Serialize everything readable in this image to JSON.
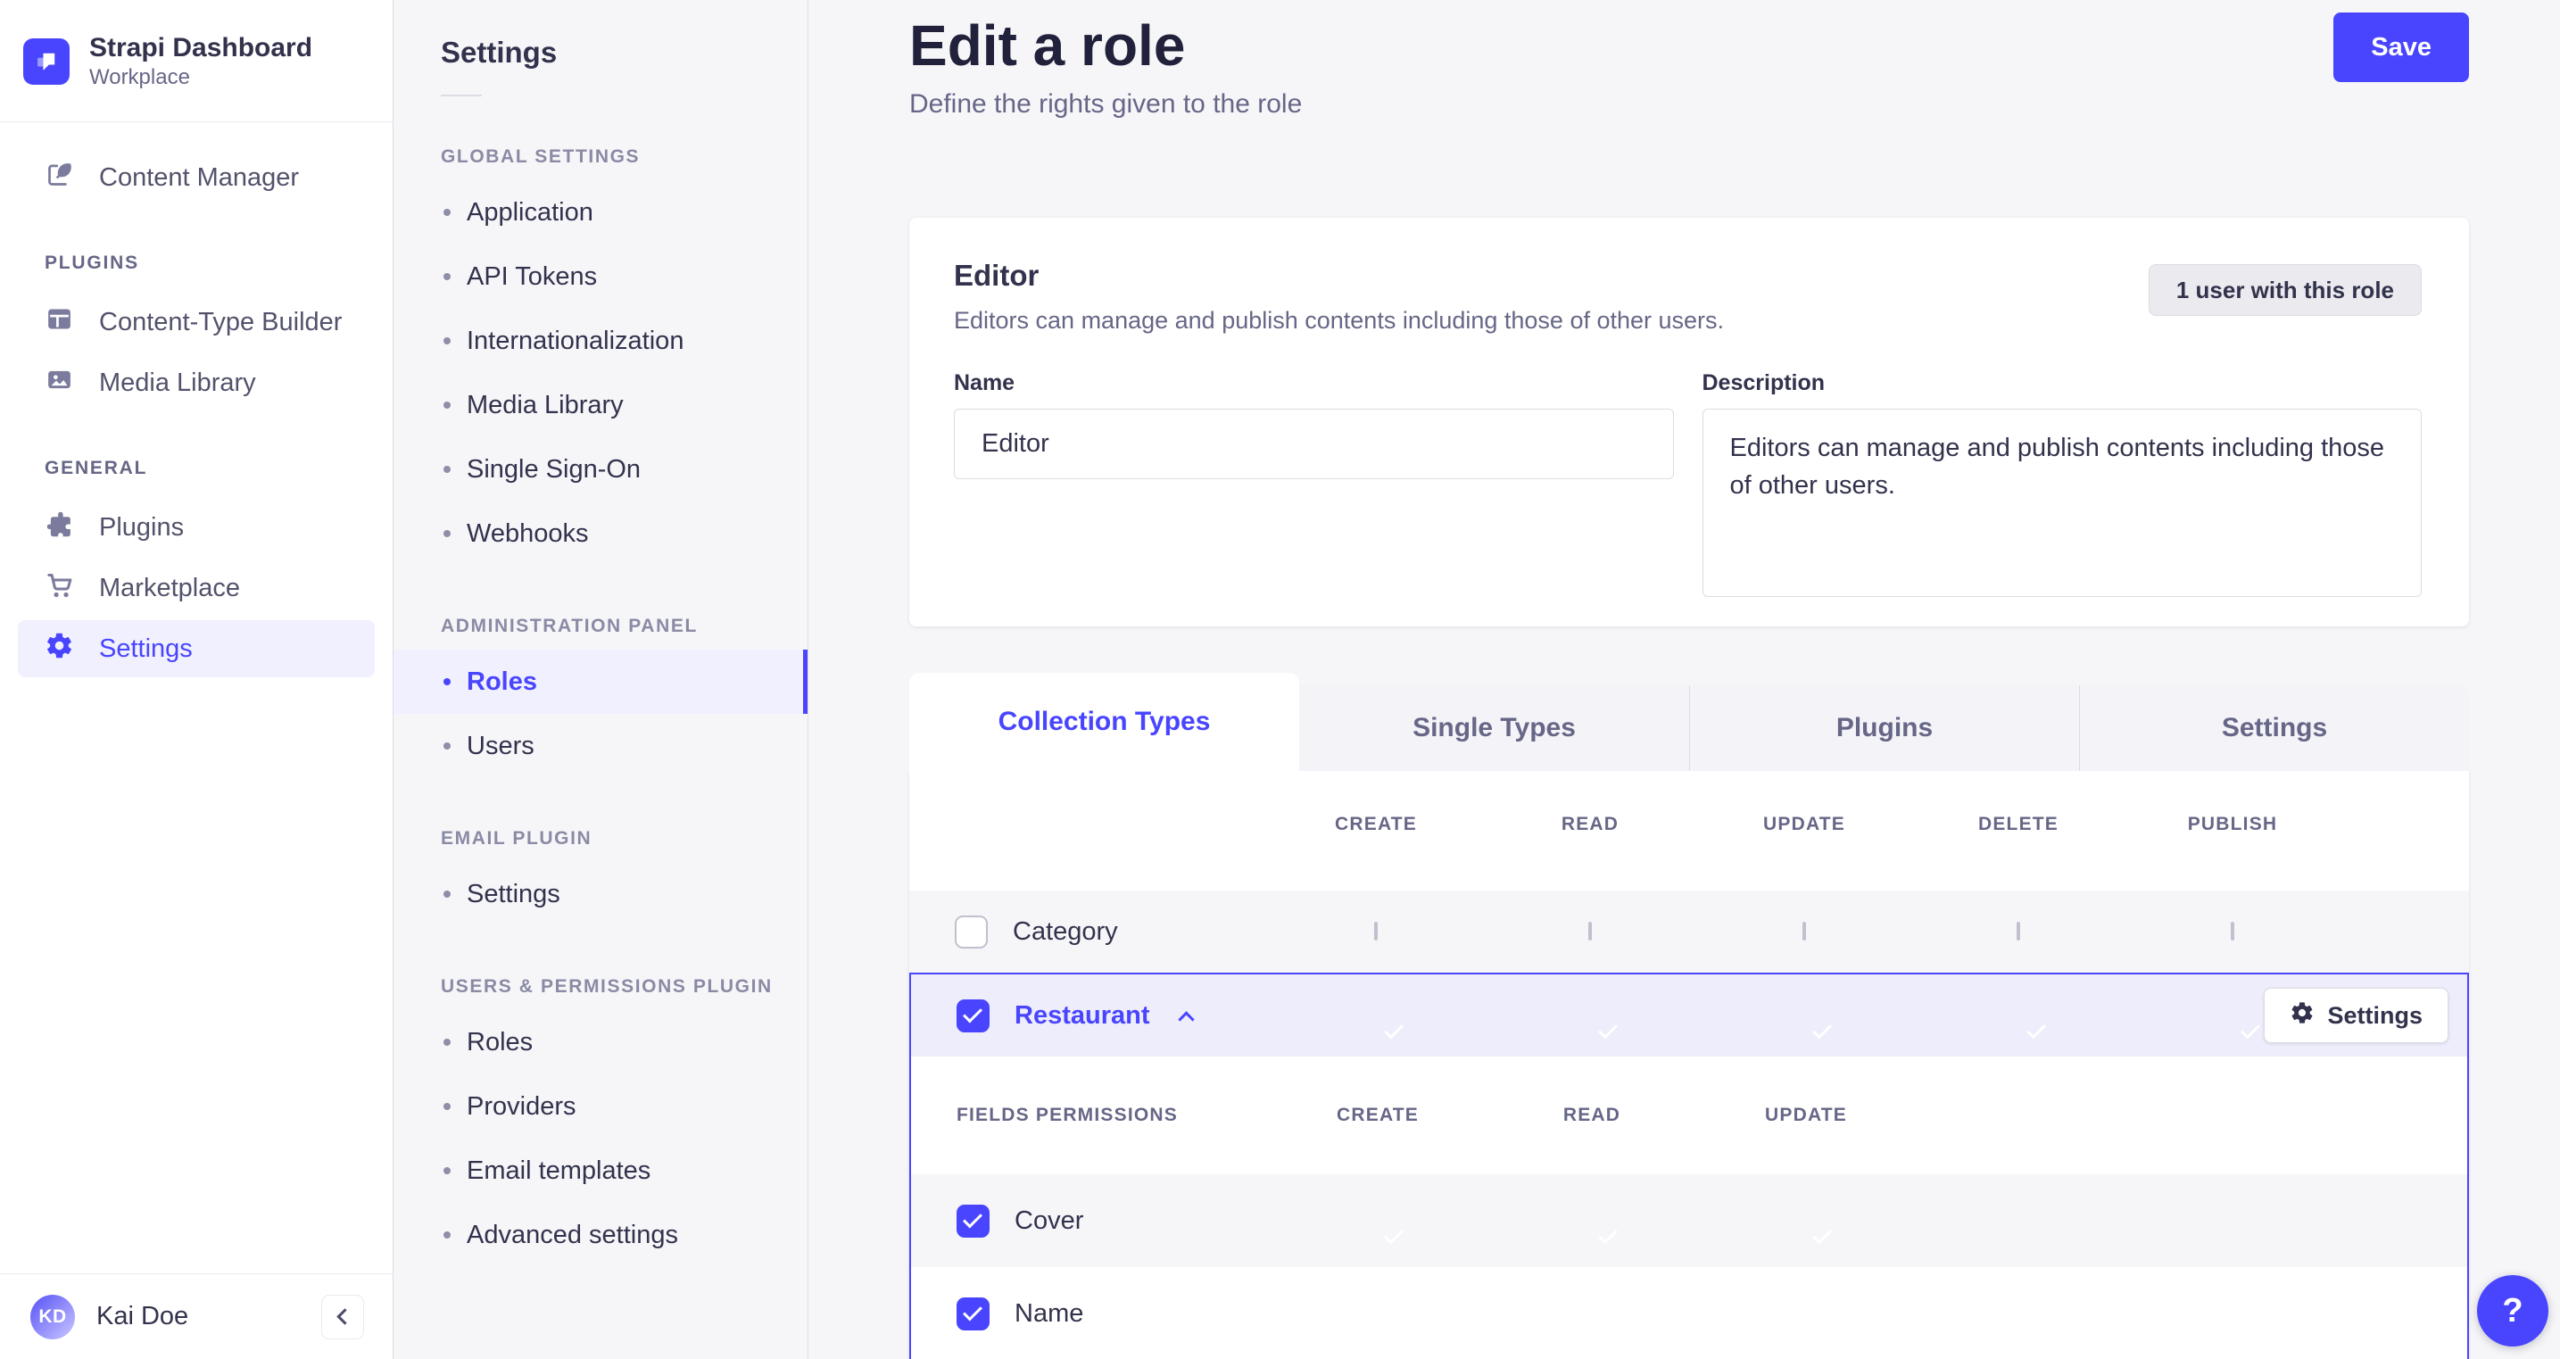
{
  "colors": {
    "primary": "#4945FF",
    "primary_light": "#F0F0FF",
    "selected_row": "#EDEDFC",
    "page_bg": "#F6F6F9",
    "border": "#DCDCE4",
    "text_dark": "#32324D",
    "text_mid": "#666687"
  },
  "brand": {
    "name": "Strapi Dashboard",
    "workspace": "Workplace"
  },
  "sidebar": {
    "content_manager": "Content Manager",
    "sections": [
      {
        "title": "PLUGINS",
        "items": [
          "Content-Type Builder",
          "Media Library"
        ]
      },
      {
        "title": "GENERAL",
        "items": [
          "Plugins",
          "Marketplace",
          "Settings"
        ]
      }
    ],
    "active_item": "Settings",
    "user": {
      "initials": "KD",
      "name": "Kai Doe"
    }
  },
  "subnav": {
    "title": "Settings",
    "sections": [
      {
        "title": "GLOBAL SETTINGS",
        "items": [
          "Application",
          "API Tokens",
          "Internationalization",
          "Media Library",
          "Single Sign-On",
          "Webhooks"
        ]
      },
      {
        "title": "ADMINISTRATION PANEL",
        "items": [
          "Roles",
          "Users"
        ]
      },
      {
        "title": "EMAIL PLUGIN",
        "items": [
          "Settings"
        ]
      },
      {
        "title": "USERS & PERMISSIONS PLUGIN",
        "items": [
          "Roles",
          "Providers",
          "Email templates",
          "Advanced settings"
        ]
      }
    ],
    "active_item": "Roles"
  },
  "header": {
    "title": "Edit a role",
    "subtitle": "Define the rights given to the role",
    "save_label": "Save"
  },
  "role_card": {
    "name": "Editor",
    "description": "Editors can manage and publish contents including those of other users.",
    "users_badge": "1 user with this role",
    "name_label": "Name",
    "name_value": "Editor",
    "description_label": "Description",
    "description_value": "Editors can manage and publish contents including those of other users."
  },
  "permissions": {
    "tabs": [
      "Collection Types",
      "Single Types",
      "Plugins",
      "Settings"
    ],
    "active_tab": "Collection Types",
    "columns": [
      "CREATE",
      "READ",
      "UPDATE",
      "DELETE",
      "PUBLISH"
    ],
    "header_checkbox_state": "indeterminate",
    "rows": [
      {
        "label": "Category",
        "row_checked": false,
        "create": false,
        "read": false,
        "update": false,
        "delete": false,
        "publish": false
      },
      {
        "label": "Restaurant",
        "row_checked": true,
        "expanded": true,
        "create": true,
        "read": true,
        "update": true,
        "delete": true,
        "publish": true,
        "settings_button": "Settings"
      }
    ],
    "fields_section": {
      "title": "FIELDS PERMISSIONS",
      "columns": [
        "CREATE",
        "READ",
        "UPDATE"
      ],
      "rows": [
        {
          "label": "Cover",
          "row_checked": true,
          "create": true,
          "read": true,
          "update": true
        },
        {
          "label": "Name",
          "row_checked": true,
          "create": true,
          "read": true,
          "update": true
        }
      ]
    }
  },
  "fab": {
    "label": "?"
  }
}
